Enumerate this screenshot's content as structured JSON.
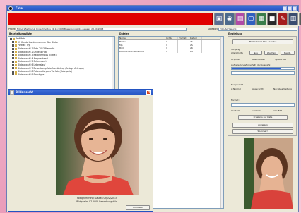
{
  "window": {
    "title": "Foto"
  },
  "toolbar": {
    "icons": [
      "photo-icon",
      "camera-icon",
      "scanner-icon",
      "monitor-icon",
      "film-icon",
      "folder-icon",
      "brush-icon",
      "graph-icon",
      "tools-icon"
    ],
    "colors": [
      "#5b6f93",
      "#4d6a8c",
      "#b04aa6",
      "#325fbf",
      "#3a7d4b",
      "#2a2a2a",
      "#a51d1d",
      "#3b4d6e",
      "#5a5a5a"
    ]
  },
  "fields": {
    "projekt_label": "Projekt",
    "projekt_value": "Fotografie-Modul: Projektmodus 01.12/2008 Bewerbungsfoto gelesen 28.04 2008",
    "kategorie_label": "Kategorie",
    "kategorie_value": "Foto-Sortierung"
  },
  "left_panel": {
    "title": "Bearbeitungsliste",
    "items": [
      "Profilfoto",
      "01 Kunde Kundennummer Alle Bilder",
      "Portrait Typ",
      "Bildauswahl 1 Foto 2013 Freundin",
      "Bildauswahl 2 Leidenz Foto",
      "Bildauswahl 3 Kalibrierfotos (Extra)",
      "Bildauswahl 4 Ansprechend",
      "Bildauswahl 5 Sehenswert",
      "Bildauswahl 6 Lebenslauf",
      "Bildauswahl 7 Bewerbungsfoto fuer Antrag (Anlage Anfrage)",
      "Bildauswahl 8 Fotostudio pass Vorfeld (Kategorie)",
      "Bildauswahl 9 Sonstiges"
    ]
  },
  "mid_panel": {
    "title": "Dateien",
    "columns": [
      "Name",
      "Größe",
      "Format",
      "Datum"
    ],
    "rows": [
      [
        "Bilder",
        "1",
        "",
        "2S"
      ],
      [
        "Mp",
        "1",
        "",
        "2S"
      ],
      [
        "Bild",
        "1",
        "",
        "26"
      ],
      [
        "Daten Privat.aufnahme",
        "1",
        "",
        "2S"
      ]
    ]
  },
  "right_panel": {
    "title": "Einstellung",
    "btn_top": "Bildmaterial Rho Laender",
    "lbl_vorgang": "Vorgang",
    "lbl_modus": "Alle Inhalte",
    "btn_1": "Neu",
    "btn_2": "Löschen",
    "btn_3": "Bearb.",
    "chk_1": "Original",
    "chk_2": "alle Dateien",
    "chk_3": "Spalterbild",
    "lbl_progress": "Aufbereitungsfortschritt der Auswahl",
    "progress": 0.78,
    "progress_color": "#2f5fd0",
    "lbl_beispiel": "Beispielbild",
    "opt_1": "A:Normal",
    "opt_2": "Ausschnitt",
    "opt_3": "Nachbearbeitung",
    "lbl_format": "Format:",
    "opt_4": "Landsch.",
    "opt_5": "alle Dat.",
    "opt_6": "Alle Bild.",
    "btn_ergebnis": "Ergebnis zur Liste",
    "btn_a": "Anzeigen",
    "btn_b": "Speichern"
  },
  "dialog": {
    "title": "Bildansicht",
    "caption_line1": "Fotografierung: Laurea 09/02/2013",
    "caption_line2": "Bildquelle: 07.2008 Bewerbungsbild",
    "ok_label": "Schließen"
  }
}
